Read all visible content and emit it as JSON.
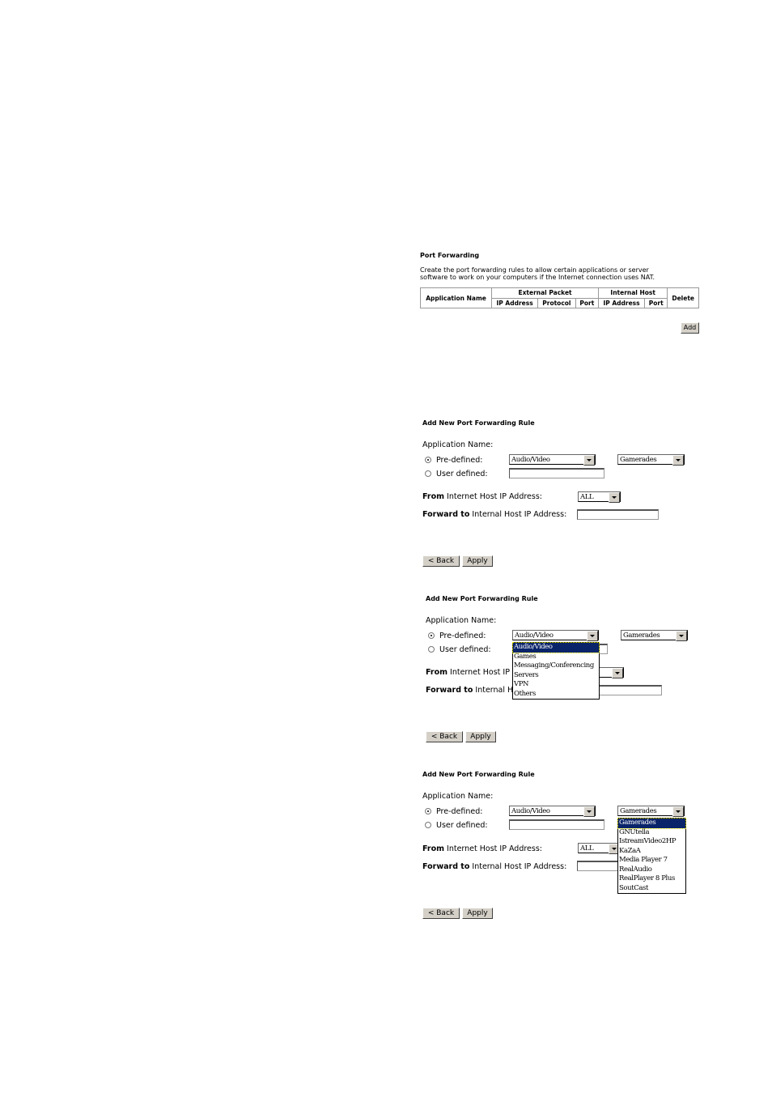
{
  "port_forwarding": {
    "title": "Port Forwarding",
    "description_line1": "Create the port forwarding rules to allow certain applications or server",
    "description_line2": "software to work on your computers if the Internet connection uses NAT.",
    "table": {
      "col_app_name": "Application Name",
      "group_external": "External Packet",
      "group_internal": "Internal Host",
      "col_delete": "Delete",
      "ext_cols": [
        "IP Address",
        "Protocol",
        "Port"
      ],
      "int_cols": [
        "IP Address",
        "Port"
      ],
      "rows": []
    },
    "add_label": "Add"
  },
  "rule_form": {
    "title": "Add New Port Forwarding Rule",
    "app_name_label": "Application Name:",
    "predefined_label": "Pre-defined:",
    "user_defined_label": "User defined:",
    "category_value": "Audio/Video",
    "app_value": "Gamerades",
    "from_bold": "From",
    "from_rest": "Internet Host IP Address:",
    "from_value": "ALL",
    "forward_bold": "Forward to",
    "forward_rest": "Internal Host IP Address:",
    "back_label": "< Back",
    "apply_label": "Apply"
  },
  "category_options": [
    "Audio/Video",
    "Games",
    "Messaging/Conferencing",
    "Servers",
    "VPN",
    "Others"
  ],
  "app_options": [
    "Gamerades",
    "GNUtella",
    "IstreamVideo2HP",
    "KaZaA",
    "Media Player 7",
    "RealAudio",
    "RealPlayer 8 Plus",
    "SoutCast"
  ]
}
